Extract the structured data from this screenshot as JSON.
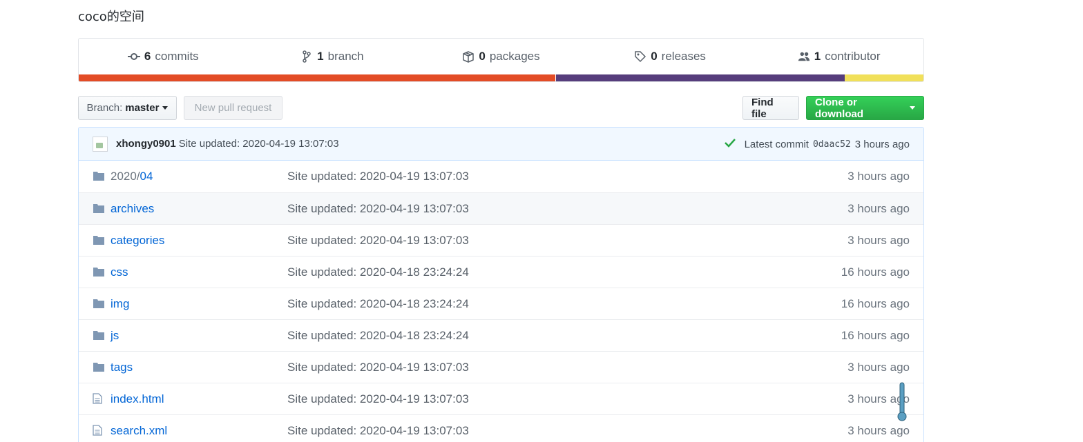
{
  "repo": {
    "description": "coco的空间"
  },
  "summary": {
    "commits": {
      "count": "6",
      "label": "commits"
    },
    "branches": {
      "count": "1",
      "label": "branch"
    },
    "packages": {
      "count": "0",
      "label": "packages"
    },
    "releases": {
      "count": "0",
      "label": "releases"
    },
    "contributors": {
      "count": "1",
      "label": "contributor"
    }
  },
  "language_bar": [
    {
      "color": "#e34c26",
      "percent": 56.5
    },
    {
      "color": "#563d7c",
      "percent": 34.2
    },
    {
      "color": "#f1e05a",
      "percent": 9.3
    }
  ],
  "toolbar": {
    "branch_label": "Branch:",
    "branch_value": "master",
    "new_pr_label": "New pull request",
    "find_file_label": "Find file",
    "clone_label": "Clone or download"
  },
  "commit": {
    "author": "xhongy0901",
    "message": "Site updated: 2020-04-19 13:07:03",
    "latest_label": "Latest commit",
    "sha": "0daac52",
    "age": "3 hours ago"
  },
  "files": [
    {
      "type": "folder",
      "prefix": "2020/",
      "name": "04",
      "message": "Site updated: 2020-04-19 13:07:03",
      "age": "3 hours ago"
    },
    {
      "type": "folder",
      "prefix": "",
      "name": "archives",
      "message": "Site updated: 2020-04-19 13:07:03",
      "age": "3 hours ago"
    },
    {
      "type": "folder",
      "prefix": "",
      "name": "categories",
      "message": "Site updated: 2020-04-19 13:07:03",
      "age": "3 hours ago"
    },
    {
      "type": "folder",
      "prefix": "",
      "name": "css",
      "message": "Site updated: 2020-04-18 23:24:24",
      "age": "16 hours ago"
    },
    {
      "type": "folder",
      "prefix": "",
      "name": "img",
      "message": "Site updated: 2020-04-18 23:24:24",
      "age": "16 hours ago"
    },
    {
      "type": "folder",
      "prefix": "",
      "name": "js",
      "message": "Site updated: 2020-04-18 23:24:24",
      "age": "16 hours ago"
    },
    {
      "type": "folder",
      "prefix": "",
      "name": "tags",
      "message": "Site updated: 2020-04-19 13:07:03",
      "age": "3 hours ago"
    },
    {
      "type": "file",
      "prefix": "",
      "name": "index.html",
      "message": "Site updated: 2020-04-19 13:07:03",
      "age": "3 hours ago"
    },
    {
      "type": "file",
      "prefix": "",
      "name": "search.xml",
      "message": "Site updated: 2020-04-19 13:07:03",
      "age": "3 hours ago"
    }
  ],
  "icons": {
    "commits": "git-commit-icon",
    "branch": "git-branch-icon",
    "packages": "package-icon",
    "releases": "tag-icon",
    "contributors": "people-icon",
    "folder": "folder-icon",
    "file": "file-icon",
    "check": "check-icon"
  }
}
